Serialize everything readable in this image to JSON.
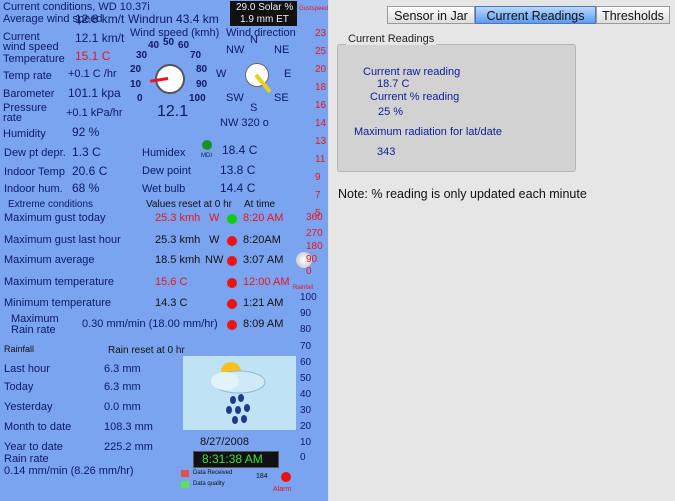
{
  "colors": {
    "panel_bg": "#7aa4f0",
    "value_red": "#e8141e",
    "dark_blue": "#0d1a66",
    "active_tab": "#5c9bef",
    "status_red": "#e11",
    "status_green": "#1c1"
  },
  "header": {
    "title": "Current conditions, WD 10.37i",
    "solar_line1": "29.0 Solar %",
    "solar_line2": "1.9 mm ET",
    "gust_label": "Gustspeed"
  },
  "conditions": [
    {
      "label": "Average wind speed",
      "value": "12.8 km/t"
    },
    {
      "label": "Current wind speed",
      "value": "12.1 km/t"
    },
    {
      "label": "Temperature",
      "value": "15.1 C"
    },
    {
      "label": "Temp rate",
      "value": "+0.1 C /hr"
    },
    {
      "label": "Barometer",
      "value": "101.1 kpa"
    },
    {
      "label": "Pressure rate",
      "value": "+0.1 kPa/hr"
    },
    {
      "label": "Humidity",
      "value": "92 %"
    },
    {
      "label": "Dew pt depr.",
      "value": "1.3 C"
    },
    {
      "label": "Indoor Temp",
      "value": "20.6 C"
    },
    {
      "label": "Indoor hum.",
      "value": "68 %"
    }
  ],
  "windrun": "Windrun 43.4 km",
  "wind_speed_title": "Wind speed (kmh)",
  "wind_dir_title": "Wind direction",
  "gauge": {
    "ticks": [
      "0",
      "10",
      "20",
      "30",
      "40",
      "50",
      "60",
      "70",
      "80",
      "90",
      "100"
    ],
    "reading": "12.1",
    "reading_value": 12.1,
    "max": 100
  },
  "compass": {
    "labels": [
      "N",
      "NE",
      "E",
      "SE",
      "S",
      "SW",
      "W",
      "NW"
    ],
    "reading": "NW 320 o",
    "direction_deg": 320
  },
  "mid": [
    {
      "label": "Humidex",
      "value": "18.4 C"
    },
    {
      "label": "Dew point",
      "value": "13.8 C"
    },
    {
      "label": "Wet bulb",
      "value": "14.4 C"
    }
  ],
  "mdi": "MDI",
  "extremes": {
    "header": "Extreme conditions",
    "reset": "Values reset at 0 hr",
    "at_time": "At time",
    "rows": [
      {
        "label": "Maximum gust today",
        "value": "25.3 kmh",
        "dir": "W",
        "time": "8:20 AM",
        "status": "green",
        "value_color": "red"
      },
      {
        "label": "Maximum gust last hour",
        "value": "25.3 kmh",
        "dir": "W",
        "time": "8:20AM",
        "status": "red",
        "value_color": "dark"
      },
      {
        "label": "Maximum average",
        "value": "18.5 kmh",
        "dir": "NW",
        "time": "3:07 AM",
        "status": "red",
        "value_color": "dark"
      },
      {
        "label": "Maximum temperature",
        "value": "15.6 C",
        "dir": "",
        "time": "12:00 AM",
        "status": "red",
        "value_color": "red"
      },
      {
        "label": "Minimum temperature",
        "value": "14.3 C",
        "dir": "",
        "time": "1:21 AM",
        "status": "red",
        "value_color": "dark"
      },
      {
        "label": "Maximum Rain rate",
        "value": "0.30 mm/min (18.00 mm/hr)",
        "dir": "",
        "time": "8:09 AM",
        "status": "red",
        "value_color": "dark"
      }
    ]
  },
  "rainfall": {
    "label": "Rainfall",
    "reset": "Rain reset at 0 hr",
    "rows": [
      {
        "label": "Last hour",
        "value": "6.3 mm"
      },
      {
        "label": "Today",
        "value": "6.3 mm"
      },
      {
        "label": "Yesterday",
        "value": "0.0 mm"
      },
      {
        "label": "Month to date",
        "value": "108.3 mm"
      },
      {
        "label": "Year to date",
        "value": "225.2 mm"
      }
    ],
    "rate_label": "Rain rate",
    "rate_value": "0.14 mm/min (8.26 mm/hr)"
  },
  "date": "8/27/2008",
  "time": "8:31:38 AM",
  "legend": {
    "received": "Data Received",
    "quality": "Data quality",
    "count": "184",
    "alarm": "Alarm"
  },
  "side_scale_top": [
    "23",
    "25",
    "20",
    "18",
    "16",
    "14",
    "13",
    "11",
    "9",
    "7",
    "5"
  ],
  "side_scale_bottom": [
    "360",
    "270",
    "180",
    "90",
    "0",
    "100",
    "90",
    "80",
    "70",
    "60",
    "50",
    "40",
    "30",
    "20",
    "10",
    "0"
  ],
  "rainfall_small": "Rainfall",
  "tabs": [
    "Sensor in Jar",
    "Current Readings",
    "Thresholds"
  ],
  "active_tab": 1,
  "current_readings": {
    "title": "Current Readings",
    "raw_label": "Current raw reading",
    "raw_value": "18.7 C",
    "pct_label": "Current % reading",
    "pct_value": "25 %",
    "max_label": "Maximum radiation for lat/date",
    "max_value": "343"
  },
  "note": "Note: % reading is only updated each minute"
}
